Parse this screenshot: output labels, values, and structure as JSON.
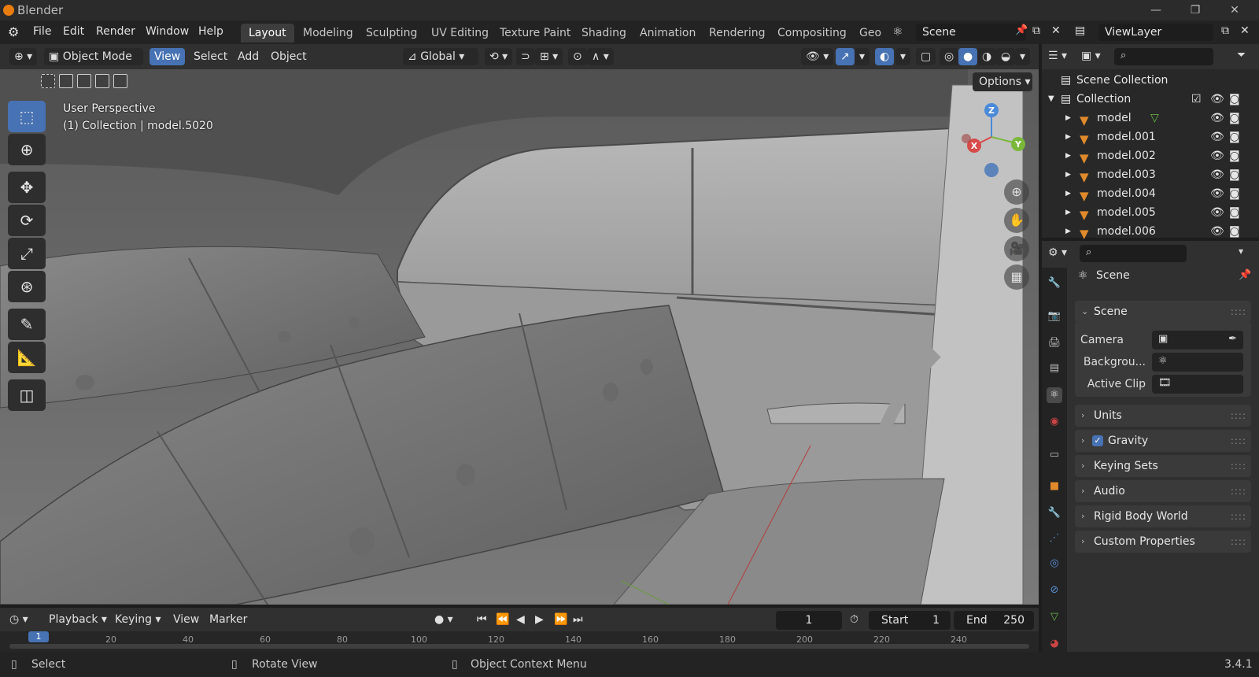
{
  "app": {
    "title": "Blender",
    "version": "3.4.1"
  },
  "menu": [
    "File",
    "Edit",
    "Render",
    "Window",
    "Help"
  ],
  "workspaces": [
    {
      "label": "Layout",
      "active": true
    },
    {
      "label": "Modeling"
    },
    {
      "label": "Sculpting"
    },
    {
      "label": "UV Editing"
    },
    {
      "label": "Texture Paint"
    },
    {
      "label": "Shading"
    },
    {
      "label": "Animation"
    },
    {
      "label": "Rendering"
    },
    {
      "label": "Compositing"
    },
    {
      "label": "Geo"
    }
  ],
  "scene_field": "Scene",
  "viewlayer_field": "ViewLayer",
  "viewport_header": {
    "mode": "Object Mode",
    "view": "View",
    "select": "Select",
    "add": "Add",
    "object": "Object",
    "orientation": "Global"
  },
  "viewport": {
    "perspective": "User Perspective",
    "collection_info": "(1) Collection | model.5020",
    "options": "Options",
    "gizmo": {
      "x": "X",
      "y": "Y",
      "z": "Z"
    }
  },
  "outliner": {
    "root": "Scene Collection",
    "collection": "Collection",
    "items": [
      "model",
      "model.001",
      "model.002",
      "model.003",
      "model.004",
      "model.005",
      "model.006"
    ]
  },
  "properties": {
    "context": "Scene",
    "section": "Scene",
    "camera_label": "Camera",
    "background_label": "Backgrou...",
    "active_clip_label": "Active Clip",
    "panels": [
      "Units",
      "Gravity",
      "Keying Sets",
      "Audio",
      "Rigid Body World",
      "Custom Properties"
    ],
    "gravity_checked": true
  },
  "timeline": {
    "playback": "Playback",
    "keying": "Keying",
    "view": "View",
    "marker": "Marker",
    "current_frame": "1",
    "start_label": "Start",
    "start": "1",
    "end_label": "End",
    "end": "250",
    "ticks": [
      "1",
      "20",
      "40",
      "60",
      "80",
      "100",
      "120",
      "140",
      "160",
      "180",
      "200",
      "220",
      "240"
    ]
  },
  "statusbar": {
    "select": "Select",
    "rotate": "Rotate View",
    "context": "Object Context Menu"
  },
  "colors": {
    "accent": "#4772b3",
    "mesh_icon": "#e18a2b",
    "background": "#1d1d1d"
  }
}
